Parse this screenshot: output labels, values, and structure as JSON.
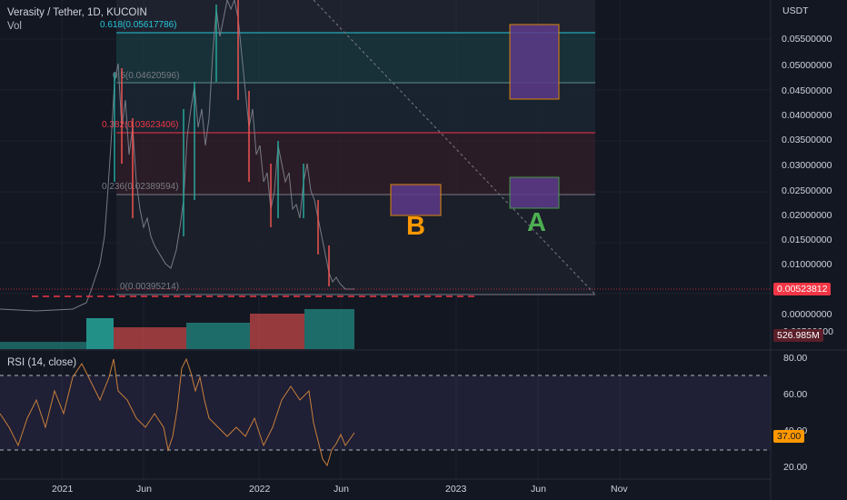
{
  "header": {
    "symbol_title": "Verasity / Tether, 1D, KUCOIN",
    "volume_label": "Vol"
  },
  "price_axis": {
    "currency": "USDT",
    "ticks": [
      "0.05500000",
      "0.05000000",
      "0.04500000",
      "0.04000000",
      "0.03500000",
      "0.03000000",
      "0.02500000",
      "0.02000000",
      "0.01500000",
      "0.01000000",
      "0.00000000",
      "-0.00500000"
    ],
    "current_price": "0.00523812",
    "volume_value": "526.985M"
  },
  "fib_levels": [
    {
      "label": "0.618(0.05617786)",
      "color": "#26c6da"
    },
    {
      "label": "0.5(0.04620596)",
      "color": "#787b86"
    },
    {
      "label": "0.382(0.03623406)",
      "color": "#f23645"
    },
    {
      "label": "0.236(0.02389594)",
      "color": "#787b86"
    },
    {
      "label": "0(0.00395214)",
      "color": "#787b86"
    }
  ],
  "annotations": {
    "zone_b_label": "B",
    "zone_a_label": "A"
  },
  "rsi": {
    "label": "RSI (14, close)",
    "ticks": [
      "80.00",
      "60.00",
      "40.00",
      "20.00"
    ],
    "current_value": "37.00"
  },
  "time_axis": {
    "ticks": [
      "2021",
      "Jun",
      "2022",
      "Jun",
      "2023",
      "Jun",
      "Nov"
    ]
  },
  "colors": {
    "background": "#131722",
    "up": "#26a69a",
    "down": "#ef5350",
    "rsi_line": "#c77f3b",
    "rsi_band": "#7e57c2",
    "zone_fill": "#5d3a8a",
    "zone_border": "#ff9800",
    "label_b": "#ff9800",
    "label_a": "#4caf50",
    "price_tag": "#f23645",
    "rsi_tag": "#ff9800"
  }
}
